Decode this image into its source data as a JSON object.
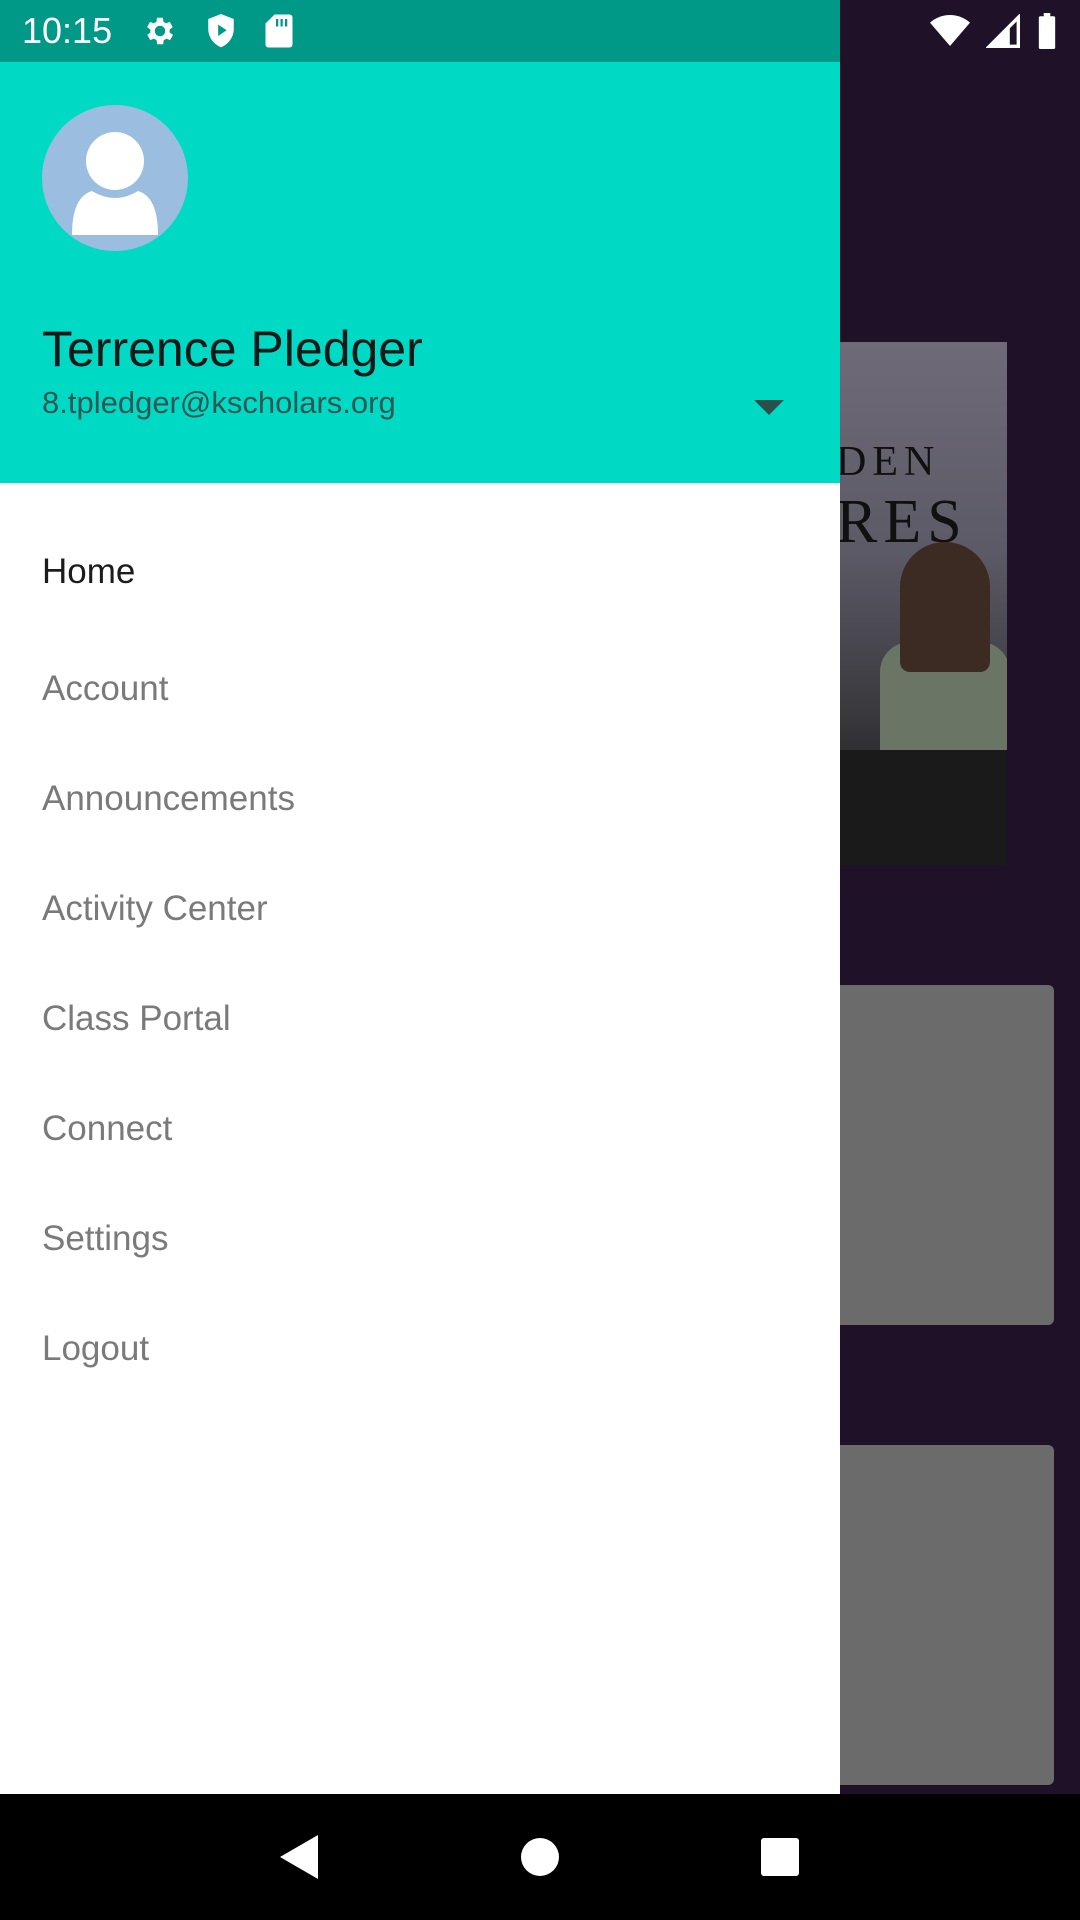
{
  "status_bar": {
    "time": "10:15",
    "left_icons": [
      "gear-icon",
      "shield-play-icon",
      "sd-card-icon"
    ],
    "right_icons": [
      "wifi-icon",
      "cellular-signal-icon",
      "battery-icon"
    ]
  },
  "background": {
    "poster_text_line1": "DEN",
    "poster_text_line2": "RES"
  },
  "drawer": {
    "header": {
      "avatar_icon": "person-icon",
      "user_name": "Terrence Pledger",
      "user_email": "8.tpledger@kscholars.org",
      "dropdown_icon": "triangle-down-icon"
    },
    "menu": [
      {
        "label": "Home",
        "active": true
      },
      {
        "label": "Account",
        "active": false
      },
      {
        "label": "Announcements",
        "active": false
      },
      {
        "label": "Activity Center",
        "active": false
      },
      {
        "label": "Class Portal",
        "active": false
      },
      {
        "label": "Connect",
        "active": false
      },
      {
        "label": "Settings",
        "active": false
      },
      {
        "label": "Logout",
        "active": false
      }
    ]
  },
  "nav_bar": {
    "buttons": [
      "back-icon",
      "home-icon",
      "recents-icon"
    ]
  },
  "colors": {
    "status_bar": "#009988",
    "header": "#00dac5",
    "background_app": "#1f1127",
    "menu_active_text": "#1c1c1c",
    "menu_text": "#7a7a7a"
  }
}
